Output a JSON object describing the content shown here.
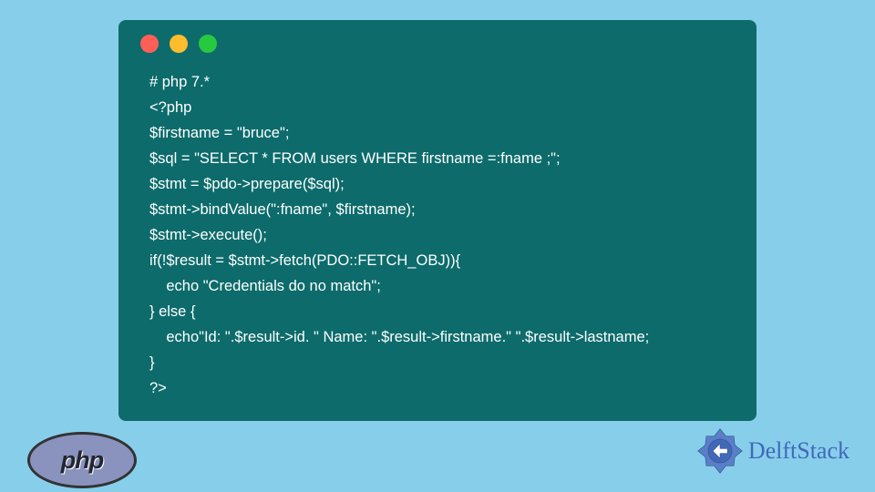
{
  "code": {
    "line1": "# php 7.*",
    "line2": "<?php",
    "line3": "$firstname = \"bruce\";",
    "line4": "$sql = \"SELECT * FROM users WHERE firstname =:fname ;\";",
    "line5": "$stmt = $pdo->prepare($sql);",
    "line6": "$stmt->bindValue(\":fname\", $firstname);",
    "line7": "$stmt->execute();",
    "line8": "if(!$result = $stmt->fetch(PDO::FETCH_OBJ)){",
    "line9": "    echo \"Credentials do no match\";",
    "line10": "} else {",
    "line11": "    echo\"Id: \".$result->id. \" Name: \".$result->firstname.\" \".$result->lastname;",
    "line12": "}",
    "line13": "?>"
  },
  "logos": {
    "php_text": "php",
    "delftstack_text": "DelftStack"
  }
}
